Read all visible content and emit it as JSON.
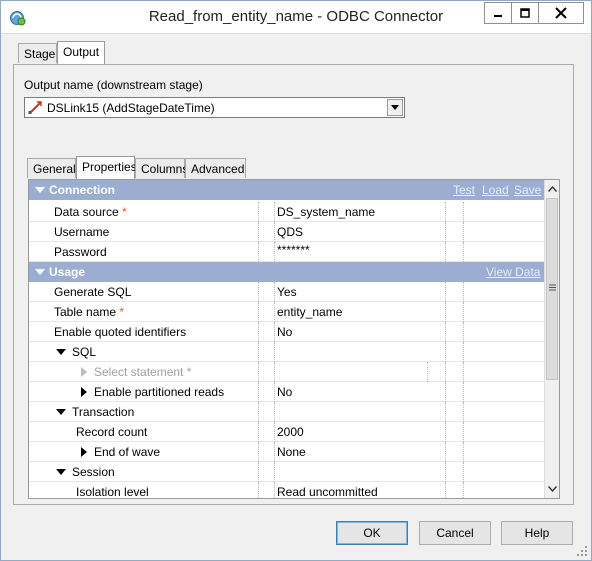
{
  "window": {
    "title": "Read_from_entity_name - ODBC Connector",
    "icons": {
      "app": "odbc-connector-icon",
      "minimize": "minimize-icon",
      "maximize": "maximize-icon",
      "close": "close-icon"
    }
  },
  "top_tabs": [
    {
      "label": "Stage",
      "active": false
    },
    {
      "label": "Output",
      "active": true
    }
  ],
  "output": {
    "label": "Output name (downstream stage)",
    "link_value": "DSLink15 (AddStageDateTime)"
  },
  "inner_tabs": [
    {
      "label": "General",
      "active": false
    },
    {
      "label": "Properties",
      "active": true
    },
    {
      "label": "Columns",
      "active": false
    },
    {
      "label": "Advanced",
      "active": false
    }
  ],
  "grid": {
    "connection": {
      "title": "Connection",
      "links": [
        "Test",
        "Load",
        "Save"
      ],
      "rows": [
        {
          "name": "Data source",
          "required": true,
          "value": "DS_system_name"
        },
        {
          "name": "Username",
          "required": false,
          "value": "QDS"
        },
        {
          "name": "Password",
          "required": false,
          "value": "*******"
        }
      ]
    },
    "usage": {
      "title": "Usage",
      "link": "View Data",
      "rows": [
        {
          "name": "Generate SQL",
          "value": "Yes"
        },
        {
          "name": "Table name",
          "required": true,
          "value": "entity_name"
        },
        {
          "name": "Enable quoted identifiers",
          "value": "No"
        },
        {
          "name": "SQL",
          "value": ""
        },
        {
          "name": "Select statement",
          "required": true,
          "value": "",
          "disabled": true
        },
        {
          "name": "Enable partitioned reads",
          "value": "No"
        },
        {
          "name": "Transaction",
          "value": ""
        },
        {
          "name": "Record count",
          "value": "2000"
        },
        {
          "name": "End of wave",
          "value": "None"
        },
        {
          "name": "Session",
          "value": ""
        },
        {
          "name": "Isolation level",
          "value": "Read uncommitted"
        }
      ]
    },
    "required_mark": "*",
    "accent": "#9badd1",
    "required_color": "#e05a2b"
  },
  "buttons": {
    "ok": "OK",
    "cancel": "Cancel",
    "help": "Help"
  }
}
